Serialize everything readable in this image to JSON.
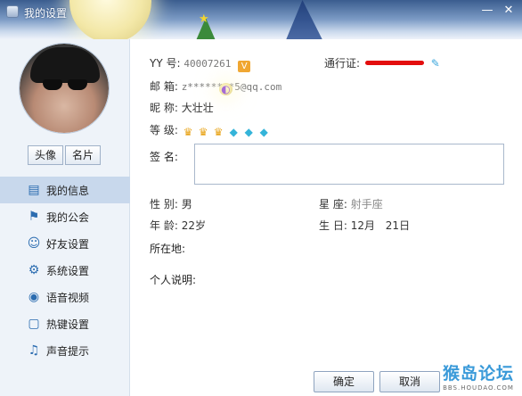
{
  "window": {
    "title": "我的设置",
    "minimize": "—",
    "close": "✕"
  },
  "profile": {
    "tab_avatar": "头像",
    "tab_card": "名片"
  },
  "sidebar": {
    "items": [
      {
        "label": "我的信息",
        "icon": "id-card-icon",
        "active": true
      },
      {
        "label": "我的公会",
        "icon": "flag-icon",
        "active": false
      },
      {
        "label": "好友设置",
        "icon": "friends-gear-icon",
        "active": false
      },
      {
        "label": "系统设置",
        "icon": "gear-icon",
        "active": false
      },
      {
        "label": "语音视频",
        "icon": "webcam-icon",
        "active": false
      },
      {
        "label": "热键设置",
        "icon": "key-square-icon",
        "active": false
      },
      {
        "label": "声音提示",
        "icon": "music-note-icon",
        "active": false
      }
    ]
  },
  "info": {
    "yy_label": "YY 号:",
    "yy_value": "40007261",
    "yy_badge": "V",
    "passport_label": "通行证:",
    "email_label": "邮  箱:",
    "email_value": "z********5@qq.com",
    "nickname_label": "昵  称:",
    "nickname_value": "大壮壮",
    "level_label": "等  级:",
    "signature_label": "签  名:",
    "gender_label": "性  别:",
    "gender_value": "男",
    "constellation_label": "星  座:",
    "constellation_value": "射手座",
    "age_label": "年  龄:",
    "age_value": "22岁",
    "birthday_label": "生  日:",
    "birthday_month": "12月",
    "birthday_day": "21日",
    "location_label": "所在地:",
    "bio_label": "个人说明:"
  },
  "footer": {
    "ok": "确定",
    "cancel": "取消"
  },
  "watermark": {
    "main": "猴岛论坛",
    "sub": "BBS.HOUDAO.COM"
  }
}
